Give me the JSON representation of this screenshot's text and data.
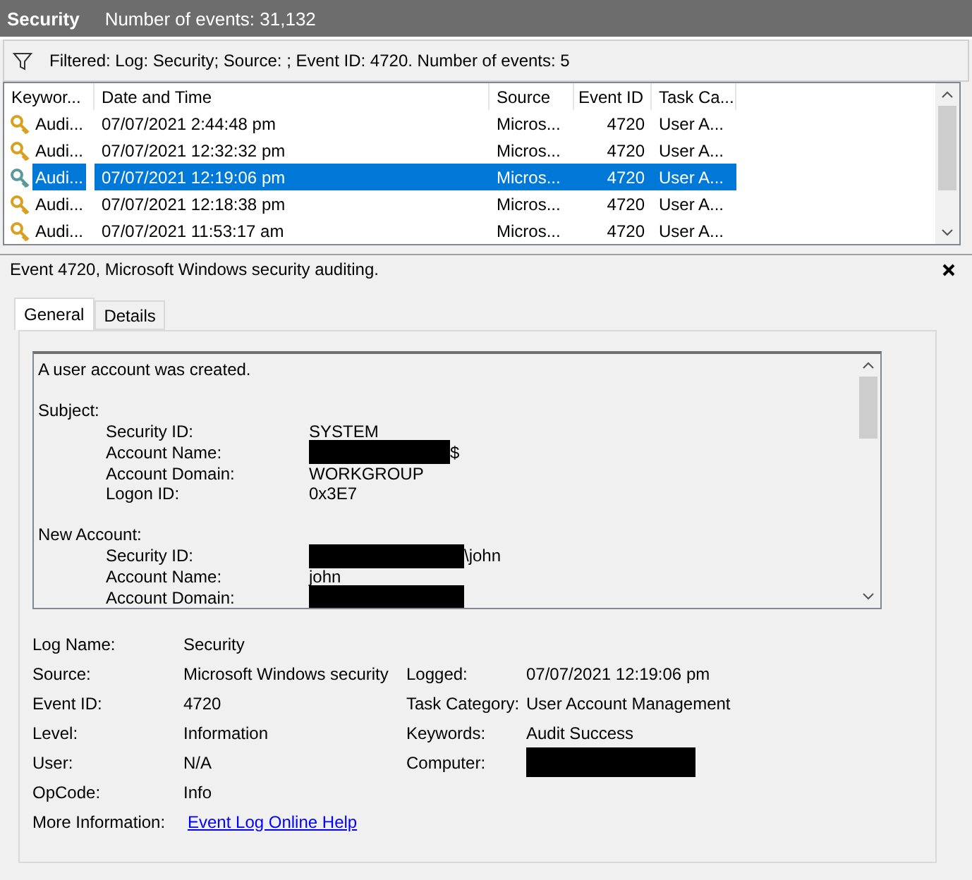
{
  "header": {
    "title": "Security",
    "count": "Number of events: 31,132"
  },
  "filter": {
    "text": "Filtered: Log: Security; Source: ; Event ID: 4720. Number of events: 5"
  },
  "table": {
    "columns": [
      "Keywor...",
      "Date and Time",
      "Source",
      "Event ID",
      "Task Ca..."
    ],
    "rows": [
      {
        "keyword": "Audi...",
        "date": "07/07/2021 2:44:48 pm",
        "source": "Micros...",
        "event_id": "4720",
        "task": "User A...",
        "selected": false
      },
      {
        "keyword": "Audi...",
        "date": "07/07/2021 12:32:32 pm",
        "source": "Micros...",
        "event_id": "4720",
        "task": "User A...",
        "selected": false
      },
      {
        "keyword": "Audi...",
        "date": "07/07/2021 12:19:06 pm",
        "source": "Micros...",
        "event_id": "4720",
        "task": "User A...",
        "selected": true
      },
      {
        "keyword": "Audi...",
        "date": "07/07/2021 12:18:38 pm",
        "source": "Micros...",
        "event_id": "4720",
        "task": "User A...",
        "selected": false
      },
      {
        "keyword": "Audi...",
        "date": "07/07/2021 11:53:17 am",
        "source": "Micros...",
        "event_id": "4720",
        "task": "User A...",
        "selected": false
      }
    ]
  },
  "detail": {
    "title": "Event 4720, Microsoft Windows security auditing.",
    "tabs": [
      {
        "label": "General",
        "selected": true
      },
      {
        "label": "Details",
        "selected": false
      }
    ],
    "message": [
      {
        "kind": "text",
        "text": "A user account was created."
      },
      {
        "kind": "blank"
      },
      {
        "kind": "heading",
        "text": "Subject:"
      },
      {
        "kind": "field",
        "label": "Security ID:",
        "value": "SYSTEM",
        "redacted": false
      },
      {
        "kind": "field",
        "label": "Account Name:",
        "value": "$",
        "redacted": true
      },
      {
        "kind": "field",
        "label": "Account Domain:",
        "value": "WORKGROUP",
        "redacted": false
      },
      {
        "kind": "field",
        "label": "Logon ID:",
        "value": "0x3E7",
        "redacted": false
      },
      {
        "kind": "blank"
      },
      {
        "kind": "heading",
        "text": "New Account:"
      },
      {
        "kind": "field",
        "label": "Security ID:",
        "value": "\\john",
        "redacted": true
      },
      {
        "kind": "field",
        "label": "Account Name:",
        "value": "john",
        "redacted": false
      },
      {
        "kind": "field",
        "label": "Account Domain:",
        "redacted": true
      }
    ],
    "properties_left": [
      {
        "label": "Log Name:",
        "value": "Security"
      },
      {
        "label": "Source:",
        "value": "Microsoft Windows security"
      },
      {
        "label": "Event ID:",
        "value": "4720"
      },
      {
        "label": "Level:",
        "value": "Information"
      },
      {
        "label": "User:",
        "value": "N/A"
      },
      {
        "label": "OpCode:",
        "value": "Info"
      },
      {
        "label": "More Information:",
        "link": "Event Log Online Help"
      }
    ],
    "properties_right": [
      {
        "label": "Logged:",
        "value": "07/07/2021 12:19:06 pm"
      },
      {
        "label": "Task Category:",
        "value": "User Account Management"
      },
      {
        "label": "Keywords:",
        "value": "Audit Success"
      },
      {
        "label": "Computer:",
        "redacted": true
      }
    ]
  }
}
